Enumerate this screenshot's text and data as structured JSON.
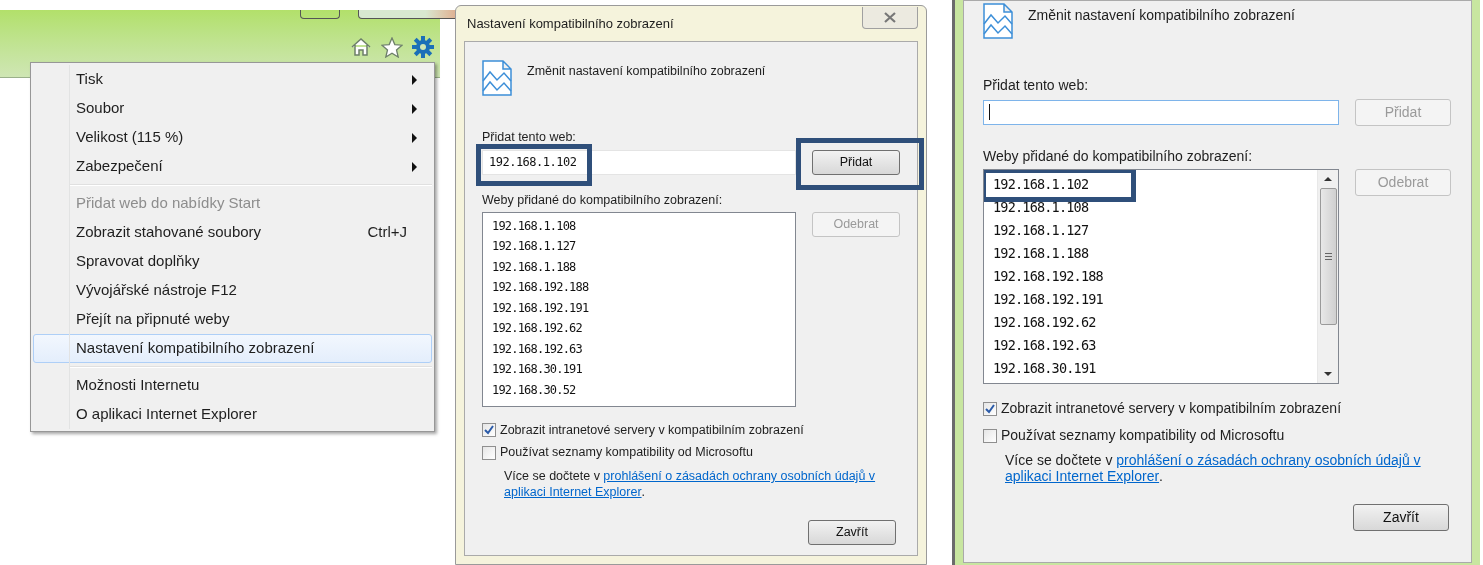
{
  "menu": {
    "groups": [
      [
        {
          "label": "Tisk",
          "submenu": true,
          "disabled": false,
          "selected": false
        },
        {
          "label": "Soubor",
          "submenu": true,
          "disabled": false,
          "selected": false
        },
        {
          "label": "Velikost (115 %)",
          "submenu": true,
          "disabled": false,
          "selected": false
        },
        {
          "label": "Zabezpečení",
          "submenu": true,
          "disabled": false,
          "selected": false
        }
      ],
      [
        {
          "label": "Přidat web do nabídky Start",
          "submenu": false,
          "disabled": true,
          "selected": false
        },
        {
          "label": "Zobrazit stahované soubory",
          "shortcut": "Ctrl+J",
          "submenu": false,
          "disabled": false,
          "selected": false
        },
        {
          "label": "Spravovat doplňky",
          "submenu": false,
          "disabled": false,
          "selected": false
        },
        {
          "label": "Vývojářské nástroje F12",
          "submenu": false,
          "disabled": false,
          "selected": false
        },
        {
          "label": "Přejít na připnuté weby",
          "submenu": false,
          "disabled": false,
          "selected": false
        },
        {
          "label": "Nastavení kompatibilního zobrazení",
          "submenu": false,
          "disabled": false,
          "selected": true
        }
      ],
      [
        {
          "label": "Možnosti Internetu",
          "submenu": false,
          "disabled": false,
          "selected": false
        },
        {
          "label": "O aplikaci Internet Explorer",
          "submenu": false,
          "disabled": false,
          "selected": false
        }
      ]
    ]
  },
  "dialogs": [
    {
      "title": "Nastavení kompatibilního zobrazení",
      "heading": "Změnit nastavení kompatibilního zobrazení",
      "add_label": "Přidat tento web:",
      "add_field": {
        "value": "192.168.1.102",
        "focused": false,
        "highlighted": true
      },
      "add_button": {
        "label": "Přidat",
        "disabled": false,
        "highlighted": true
      },
      "list_label": "Weby přidané do kompatibilního zobrazení:",
      "sites": [
        {
          "text": "192.168.1.108",
          "highlighted": false
        },
        {
          "text": "192.168.1.127",
          "highlighted": false
        },
        {
          "text": "192.168.1.188",
          "highlighted": false
        },
        {
          "text": "192.168.192.188",
          "highlighted": false
        },
        {
          "text": "192.168.192.191",
          "highlighted": false
        },
        {
          "text": "192.168.192.62",
          "highlighted": false
        },
        {
          "text": "192.168.192.63",
          "highlighted": false
        },
        {
          "text": "192.168.30.191",
          "highlighted": false
        },
        {
          "text": "192.168.30.52",
          "highlighted": false
        }
      ],
      "scrollbar": false,
      "remove_button": {
        "label": "Odebrat",
        "disabled": true
      },
      "checkboxes": [
        {
          "label": "Zobrazit intranetové servery v kompatibilním zobrazení",
          "checked": true
        },
        {
          "label": "Používat seznamy kompatibility od Microsoftu",
          "checked": false
        }
      ],
      "info": {
        "text": "Více se dočtete v",
        "link_lines": [
          "prohlášení o zásadách ochrany osobních údajů v",
          "aplikaci Internet Explorer"
        ],
        "end": "."
      },
      "close_button": "Zavřít"
    },
    {
      "heading": "Změnit nastavení kompatibilního zobrazení",
      "add_label": "Přidat tento web:",
      "add_field": {
        "focused": true,
        "highlighted": false
      },
      "add_button": {
        "label": "Přidat",
        "disabled": true,
        "highlighted": false
      },
      "list_label": "Weby přidané do kompatibilního zobrazení:",
      "sites": [
        {
          "text": "192.168.1.102",
          "highlighted": true
        },
        {
          "text": "192.168.1.108",
          "highlighted": false
        },
        {
          "text": "192.168.1.127",
          "highlighted": false
        },
        {
          "text": "192.168.1.188",
          "highlighted": false
        },
        {
          "text": "192.168.192.188",
          "highlighted": false
        },
        {
          "text": "192.168.192.191",
          "highlighted": false
        },
        {
          "text": "192.168.192.62",
          "highlighted": false
        },
        {
          "text": "192.168.192.63",
          "highlighted": false
        },
        {
          "text": "192.168.30.191",
          "highlighted": false
        }
      ],
      "scrollbar": true,
      "remove_button": {
        "label": "Odebrat",
        "disabled": true
      },
      "checkboxes": [
        {
          "label": "Zobrazit intranetové servery v kompatibilním zobrazení",
          "checked": true
        },
        {
          "label": "Používat seznamy kompatibility od Microsoftu",
          "checked": false
        }
      ],
      "info": {
        "text": "Více se dočtete v",
        "link_lines": [
          "prohlášení o zásadách ochrany osobních údajů v",
          "aplikaci Internet Explorer"
        ],
        "end": "."
      },
      "close_button": "Zavřít"
    }
  ]
}
